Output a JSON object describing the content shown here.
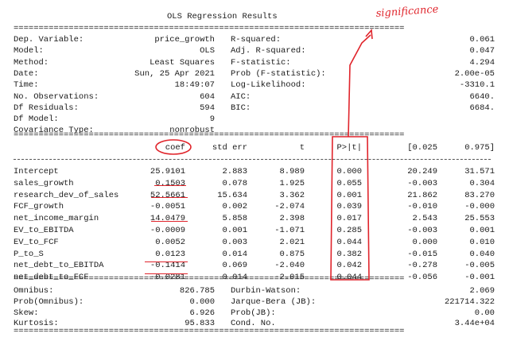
{
  "title": "OLS Regression Results",
  "separators": {
    "double": "==============================================================================",
    "single": "------------------------------------------------------------------------------"
  },
  "model_info": {
    "left": [
      {
        "label": "Dep. Variable:",
        "value": "price_growth"
      },
      {
        "label": "Model:",
        "value": "OLS"
      },
      {
        "label": "Method:",
        "value": "Least Squares"
      },
      {
        "label": "Date:",
        "value": "Sun, 25 Apr 2021"
      },
      {
        "label": "Time:",
        "value": "18:49:07"
      },
      {
        "label": "No. Observations:",
        "value": "604"
      },
      {
        "label": "Df Residuals:",
        "value": "594"
      },
      {
        "label": "Df Model:",
        "value": "9"
      },
      {
        "label": "Covariance Type:",
        "value": "nonrobust"
      }
    ],
    "right": [
      {
        "label": "R-squared:",
        "value": "0.061"
      },
      {
        "label": "Adj. R-squared:",
        "value": "0.047"
      },
      {
        "label": "F-statistic:",
        "value": "4.294"
      },
      {
        "label": "Prob (F-statistic):",
        "value": "2.00e-05"
      },
      {
        "label": "Log-Likelihood:",
        "value": "-3310.1"
      },
      {
        "label": "AIC:",
        "value": "6640."
      },
      {
        "label": "BIC:",
        "value": "6684."
      }
    ]
  },
  "coef_table": {
    "headers": [
      "coef",
      "std err",
      "t",
      "P>|t|",
      "[0.025",
      "0.975]"
    ],
    "rows": [
      {
        "name": "Intercept",
        "coef": "25.9101",
        "std_err": "2.883",
        "t": "8.989",
        "p": "0.000",
        "lo": "20.249",
        "hi": "31.571"
      },
      {
        "name": "sales_growth",
        "coef": "0.1503",
        "std_err": "0.078",
        "t": "1.925",
        "p": "0.055",
        "lo": "-0.003",
        "hi": "0.304"
      },
      {
        "name": "research_dev_of_sales",
        "coef": "52.5661",
        "std_err": "15.634",
        "t": "3.362",
        "p": "0.001",
        "lo": "21.862",
        "hi": "83.270"
      },
      {
        "name": "FCF_growth",
        "coef": "-0.0051",
        "std_err": "0.002",
        "t": "-2.074",
        "p": "0.039",
        "lo": "-0.010",
        "hi": "-0.000"
      },
      {
        "name": "net_income_margin",
        "coef": "14.0479",
        "std_err": "5.858",
        "t": "2.398",
        "p": "0.017",
        "lo": "2.543",
        "hi": "25.553"
      },
      {
        "name": "EV_to_EBITDA",
        "coef": "-0.0009",
        "std_err": "0.001",
        "t": "-1.071",
        "p": "0.285",
        "lo": "-0.003",
        "hi": "0.001"
      },
      {
        "name": "EV_to_FCF",
        "coef": "0.0052",
        "std_err": "0.003",
        "t": "2.021",
        "p": "0.044",
        "lo": "0.000",
        "hi": "0.010"
      },
      {
        "name": "P_to_S",
        "coef": "0.0123",
        "std_err": "0.014",
        "t": "0.875",
        "p": "0.382",
        "lo": "-0.015",
        "hi": "0.040"
      },
      {
        "name": "net_debt_to_EBITDA",
        "coef": "-0.1414",
        "std_err": "0.069",
        "t": "-2.040",
        "p": "0.042",
        "lo": "-0.278",
        "hi": "-0.005"
      },
      {
        "name": "net_debt_to_FCF",
        "coef": "-0.0281",
        "std_err": "0.014",
        "t": "-2.015",
        "p": "0.044",
        "lo": "-0.056",
        "hi": "-0.001"
      }
    ]
  },
  "diagnostics": {
    "left": [
      {
        "label": "Omnibus:",
        "value": "826.785"
      },
      {
        "label": "Prob(Omnibus):",
        "value": "0.000"
      },
      {
        "label": "Skew:",
        "value": "6.926"
      },
      {
        "label": "Kurtosis:",
        "value": "95.833"
      }
    ],
    "right": [
      {
        "label": "Durbin-Watson:",
        "value": "2.069"
      },
      {
        "label": "Jarque-Bera (JB):",
        "value": "221714.322"
      },
      {
        "label": "Prob(JB):",
        "value": "0.00"
      },
      {
        "label": "Cond. No.",
        "value": "3.44e+04"
      }
    ]
  },
  "annotation": {
    "text": "significance",
    "color": "#e0242b"
  }
}
